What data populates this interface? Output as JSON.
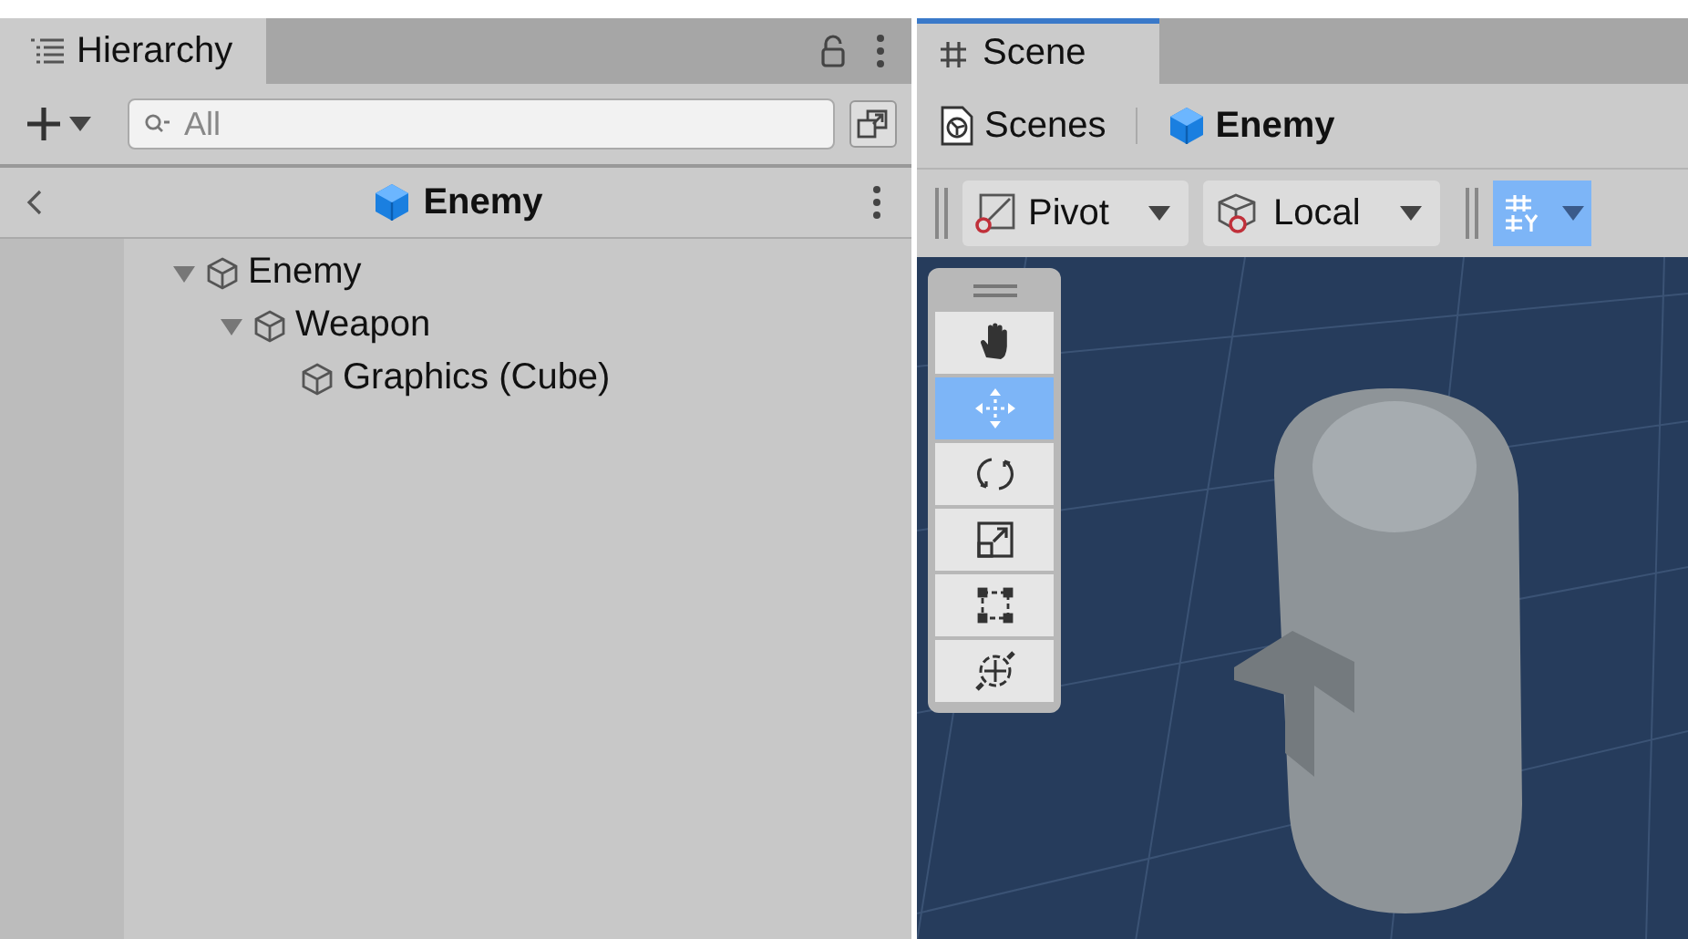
{
  "hierarchy": {
    "tab": {
      "label": "Hierarchy",
      "selected": true
    },
    "search": {
      "placeholder": "All"
    },
    "breadcrumb": {
      "label": "Enemy"
    },
    "tree": [
      {
        "label": "Enemy",
        "expanded": true,
        "children": [
          {
            "label": "Weapon",
            "expanded": true,
            "children": [
              {
                "label": "Graphics (Cube)"
              }
            ]
          }
        ]
      }
    ]
  },
  "scene": {
    "tab": {
      "label": "Scene",
      "selected": true
    },
    "breadcrumbs": [
      {
        "label": "Scenes",
        "kind": "scenes"
      },
      {
        "label": "Enemy",
        "kind": "prefab"
      }
    ],
    "toolbar": {
      "pivot": "Pivot",
      "space": "Local",
      "grid_snap_on": true
    },
    "tools": [
      {
        "kind": "hand",
        "selected": false
      },
      {
        "kind": "move",
        "selected": true
      },
      {
        "kind": "rotate",
        "selected": false
      },
      {
        "kind": "scale",
        "selected": false
      },
      {
        "kind": "rect",
        "selected": false
      },
      {
        "kind": "transform",
        "selected": false
      }
    ]
  }
}
